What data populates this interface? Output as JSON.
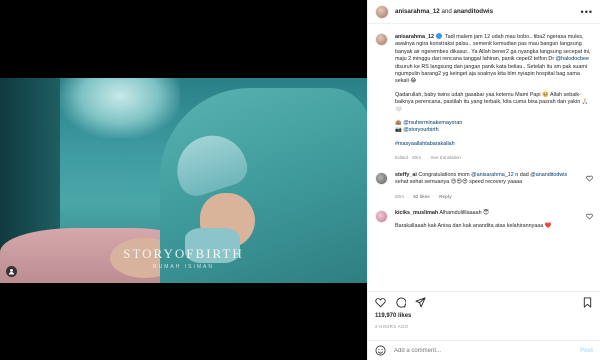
{
  "header": {
    "user1": "anisarahma_12",
    "and_text": "and",
    "user2": "ananditodwis",
    "more": "•••"
  },
  "media": {
    "watermark": "STORYOFBIRTH",
    "watermark_sub": "RUMAH ISIMAN"
  },
  "caption": {
    "username": "anisarahma_12",
    "p1": "Tadi malem jam 12 udah mau bobo.. tiba2 ngerasa mules, awalnya ngira konstraksi palsu.. semenit kemudian pas mau bangun langsung banyak air ngerembes dikasur.. Ya Allah bener2 ga nyangka langsung secepat ini, maju 2 minggu dari rencana tanggal lahiran, panik cepet2 telfon Dr",
    "p1_mention": "@halodocbee",
    "p1_tail": "disuruh ke RS langsung dan jangan panik kata beliau.. Setelah itu sm pak suami ngumpulin barang2 yg keinget aja soalnya kita blm nyiapin hospital bag sama sekali 😂",
    "p2": "Qadarullah, baby twins udah gasabar yaa ketemu Mami Papi 🥹 Allah sebaik-baiknya perencana, pastilah itu yang terbaik, kita cuma bisa pasrah dan yakin 🙏🏻🤍",
    "p3_line1": "🏨 @rsuherminakemayoran",
    "p3_line2": "📷 @storyourbirth",
    "hashtag": "#masyaallahtabarakallah",
    "meta_edited": "Edited · 50m",
    "meta_translation": "See translation"
  },
  "comments": [
    {
      "username": "steffy_ai",
      "text_pre": "Congratulations mom",
      "mention1": "@anisarahma_12",
      "text_mid": "n dad",
      "mention2": "@ananditodwis",
      "text_post": "sehat sehat semuanya 😍😍😍 speed recovery yaaaa",
      "time": "50m",
      "likes": "52 likes",
      "reply": "Reply"
    },
    {
      "username": "kiciks_muslimah",
      "text": "Alhamdulilllaaaah 😇",
      "text2": "Barakallaaah kak Anisa dan kak anandita atas kelahirannyaaa ❤️"
    }
  ],
  "likes_count": "119,970 likes",
  "time_ago": "2 HOURS AGO",
  "add_comment": {
    "placeholder": "Add a comment...",
    "post": "Post"
  },
  "colors": {
    "link": "#00376b",
    "muted": "#8e8e8e",
    "post_disabled": "#b2dffc",
    "verified": "#3897f0"
  }
}
